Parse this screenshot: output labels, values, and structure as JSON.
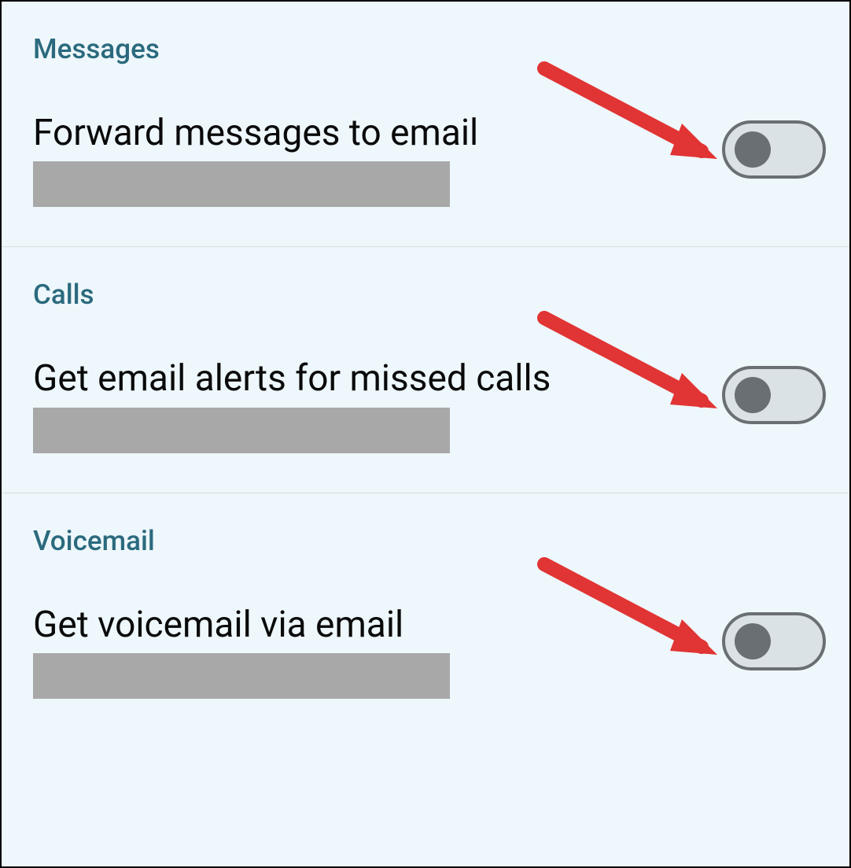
{
  "sections": {
    "messages": {
      "header": "Messages",
      "title": "Forward messages to email",
      "toggle_state": "off"
    },
    "calls": {
      "header": "Calls",
      "title": "Get email alerts for missed calls",
      "toggle_state": "off"
    },
    "voicemail": {
      "header": "Voicemail",
      "title": "Get voicemail via email",
      "toggle_state": "off"
    }
  }
}
